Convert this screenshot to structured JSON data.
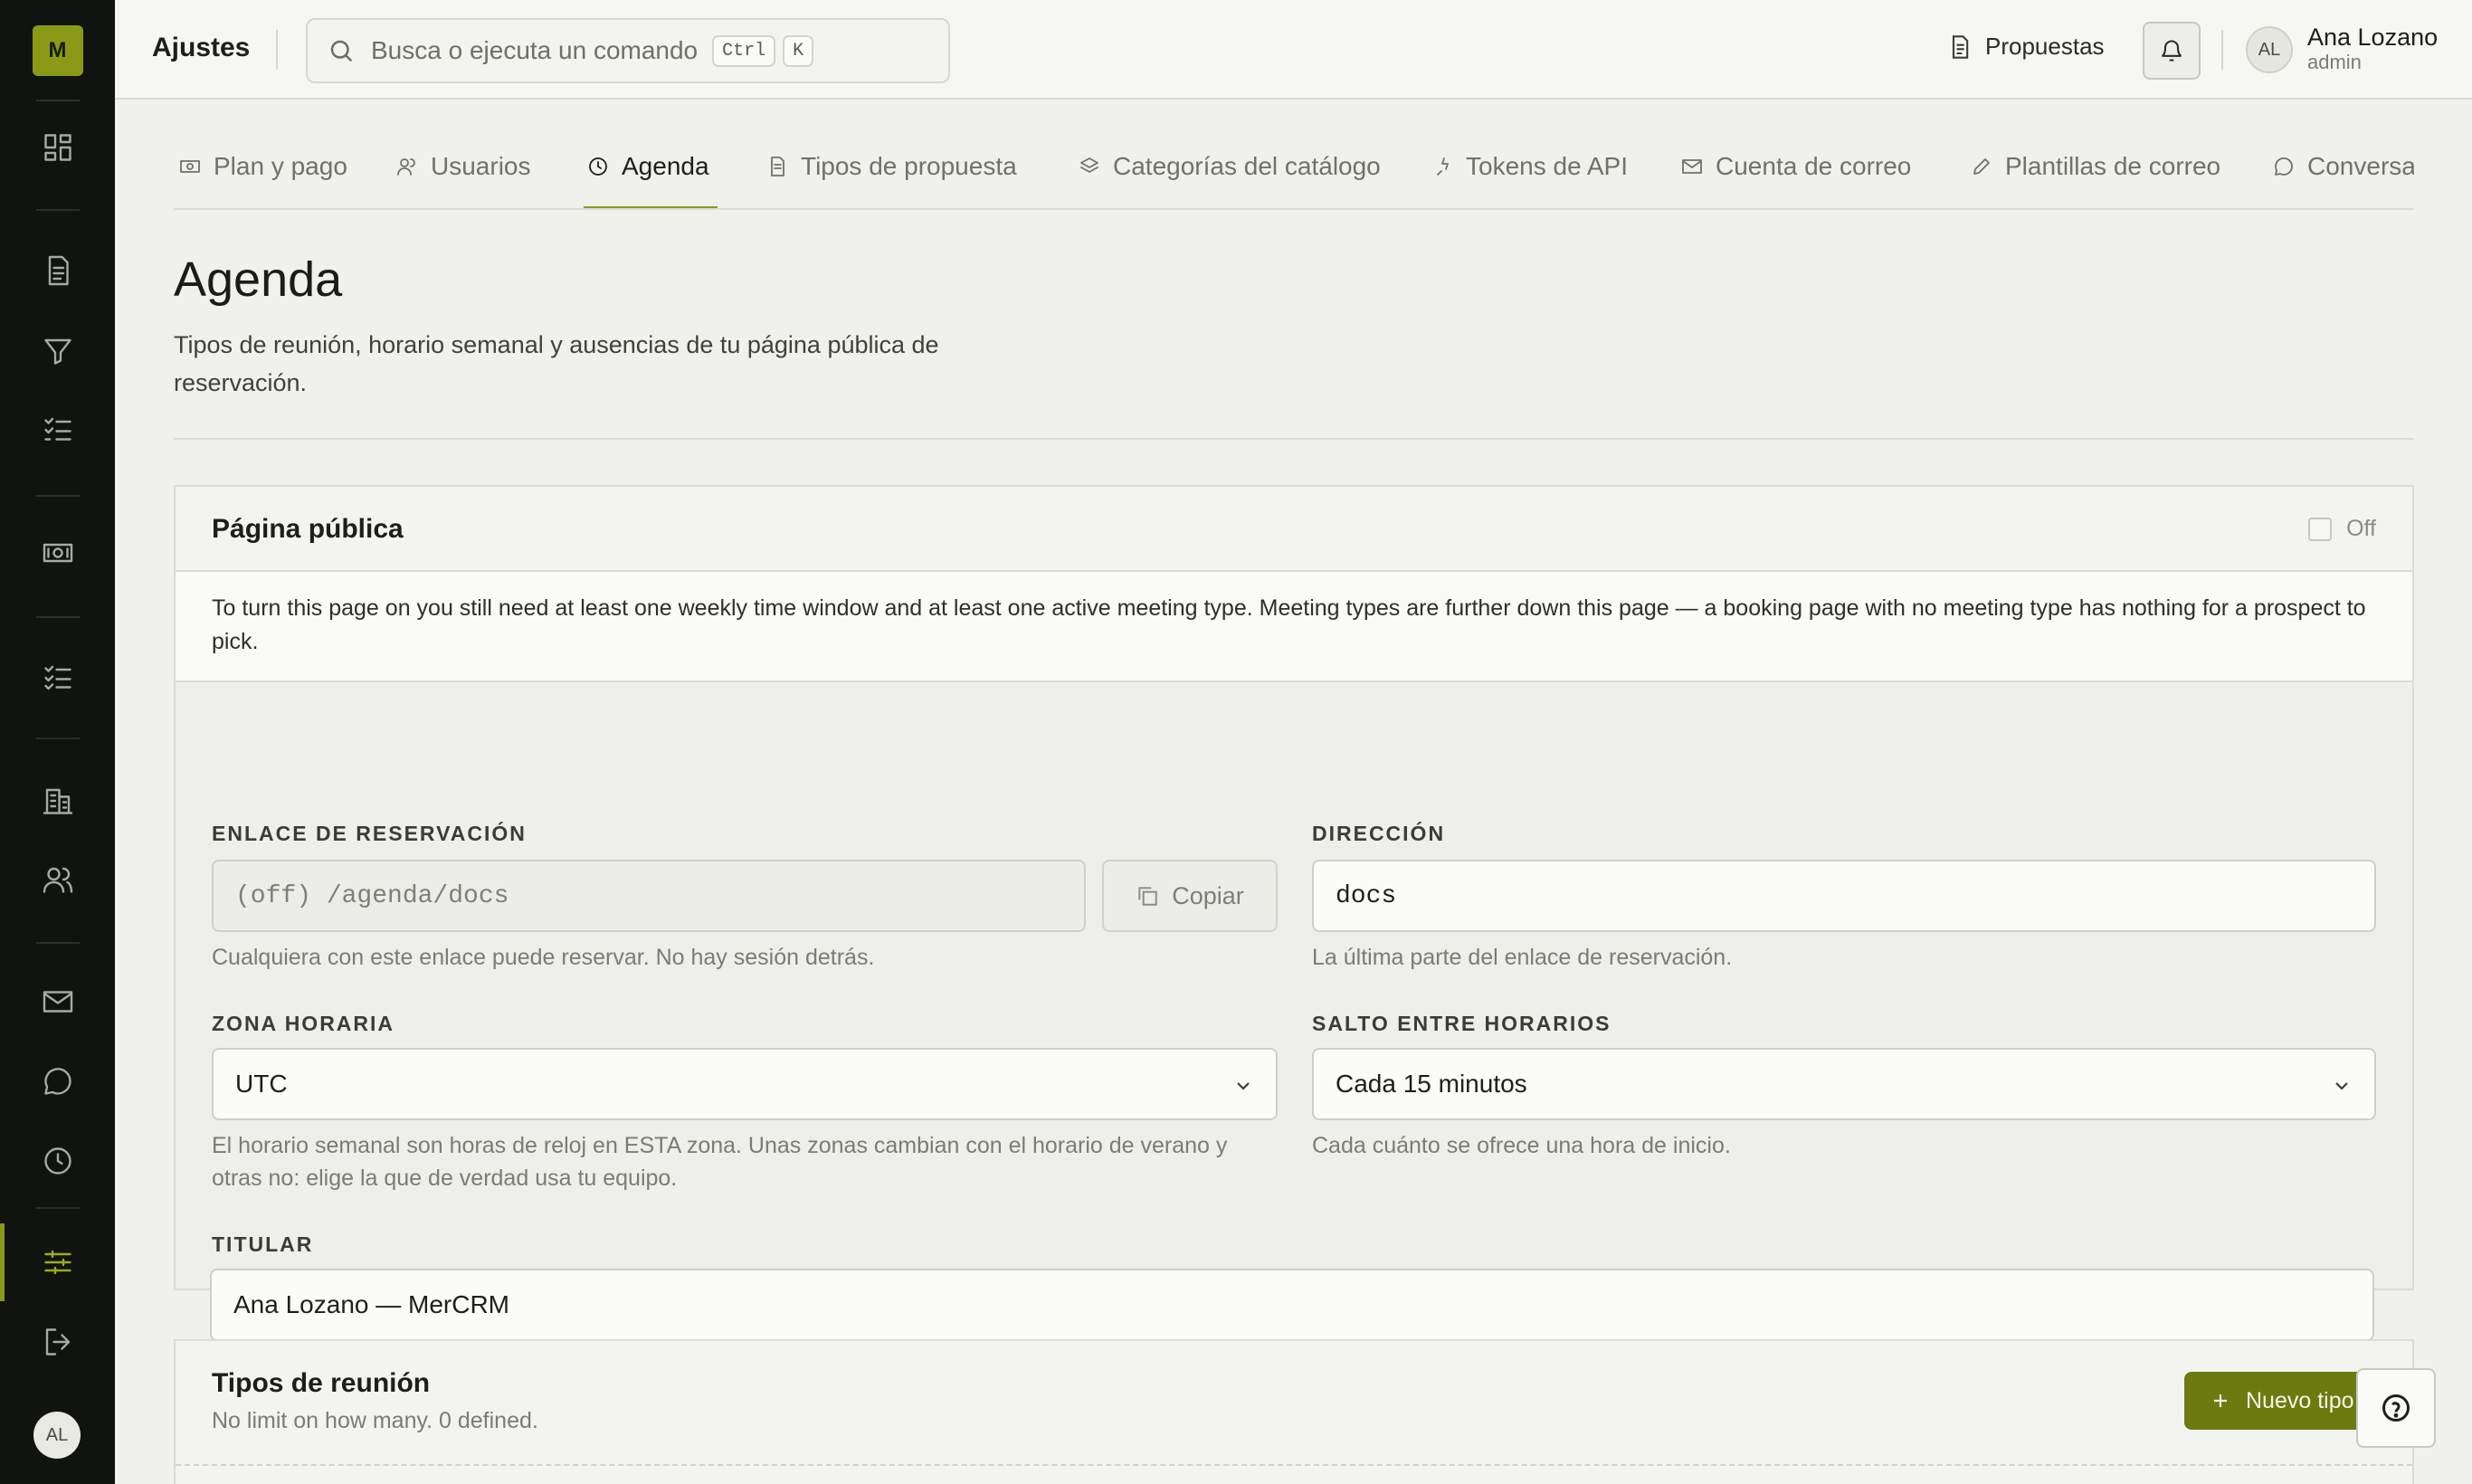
{
  "app": {
    "logo_letter": "M",
    "breadcrumb": "Ajustes",
    "accent_color": "#8b9a16"
  },
  "sidebar": {
    "items": [
      {
        "icon": "dashboard-icon"
      },
      {
        "icon": "document-icon"
      },
      {
        "icon": "filter-icon"
      },
      {
        "icon": "checklist-icon"
      },
      {
        "icon": "banknote-icon"
      },
      {
        "icon": "tasks-icon"
      },
      {
        "icon": "building-icon"
      },
      {
        "icon": "users-icon"
      },
      {
        "icon": "mail-icon"
      },
      {
        "icon": "chat-icon"
      },
      {
        "icon": "clock-icon"
      },
      {
        "icon": "settings-sliders-icon",
        "active": true
      },
      {
        "icon": "logout-icon"
      }
    ],
    "avatar_initials": "AL"
  },
  "search": {
    "placeholder": "Busca o ejecuta un comando",
    "kbd_1": "Ctrl",
    "kbd_2": "K"
  },
  "header": {
    "proposals_label": "Propuestas",
    "user_initials": "AL",
    "user_name": "Ana Lozano",
    "user_role": "admin"
  },
  "tabs": [
    {
      "label": "Plan y pago",
      "icon": "banknote-icon"
    },
    {
      "label": "Usuarios",
      "icon": "users-icon"
    },
    {
      "label": "Agenda",
      "icon": "clock-icon",
      "active": true
    },
    {
      "label": "Tipos de propuesta",
      "icon": "document-icon"
    },
    {
      "label": "Categorías del catálogo",
      "icon": "layers-icon"
    },
    {
      "label": "Tokens de API",
      "icon": "plug-icon"
    },
    {
      "label": "Cuenta de correo",
      "icon": "mail-icon"
    },
    {
      "label": "Plantillas de correo",
      "icon": "pencil-icon"
    },
    {
      "label": "Conversa",
      "icon": "chat-icon"
    }
  ],
  "page": {
    "title": "Agenda",
    "description": "Tipos de reunión, horario semanal y ausencias de tu página pública de reservación."
  },
  "public_page": {
    "title": "Página pública",
    "toggle_label": "Off",
    "notice": "To turn this page on you still need at least one weekly time window and at least one active meeting type. Meeting types are further down this page — a booking page with no meeting type has nothing for a prospect to pick.",
    "booking_link": {
      "label": "ENLACE DE RESERVACIÓN",
      "value": "(off) /agenda/docs",
      "copy_label": "Copiar",
      "hint": "Cualquiera con este enlace puede reservar. No hay sesión detrás."
    },
    "address": {
      "label": "DIRECCIÓN",
      "value": "docs",
      "hint": "La última parte del enlace de reservación."
    },
    "timezone": {
      "label": "ZONA HORARIA",
      "value": "UTC",
      "hint": "El horario semanal son horas de reloj en ESTA zona. Unas zonas cambian con el horario de verano y otras no: elige la que de verdad usa tu equipo."
    },
    "slot_step": {
      "label": "SALTO ENTRE HORARIOS",
      "value": "Cada 15 minutos",
      "hint": "Cada cuánto se ofrece una hora de inicio."
    },
    "headline": {
      "label": "TITULAR",
      "value": "Ana Lozano — MerCRM"
    }
  },
  "meeting_types": {
    "title": "Tipos de reunión",
    "subtitle": "No limit on how many. 0 defined.",
    "new_button": "Nuevo tipo"
  }
}
